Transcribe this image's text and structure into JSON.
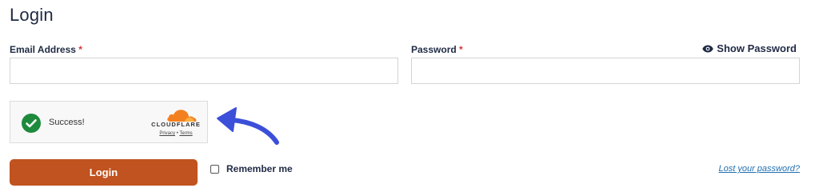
{
  "form": {
    "title": "Login",
    "email": {
      "label": "Email Address",
      "required_mark": "*",
      "value": ""
    },
    "password": {
      "label": "Password",
      "required_mark": "*",
      "value": "",
      "show_label": "Show Password",
      "show_icon": "eye-icon"
    },
    "captcha": {
      "status": "Success!",
      "status_icon": "check-circle-icon",
      "brand": "CLOUDFLARE",
      "privacy_label": "Privacy",
      "separator": "•",
      "terms_label": "Terms"
    },
    "submit_label": "Login",
    "remember_label": "Remember me",
    "remember_checked": false,
    "lost_password_label": "Lost your password?"
  },
  "colors": {
    "submit_bg": "#c0531f",
    "success_green": "#1e8a3c",
    "cloudflare_orange": "#f38020",
    "annotation_arrow": "#3b4fd9",
    "link": "#2271b1",
    "required": "#d63638"
  }
}
